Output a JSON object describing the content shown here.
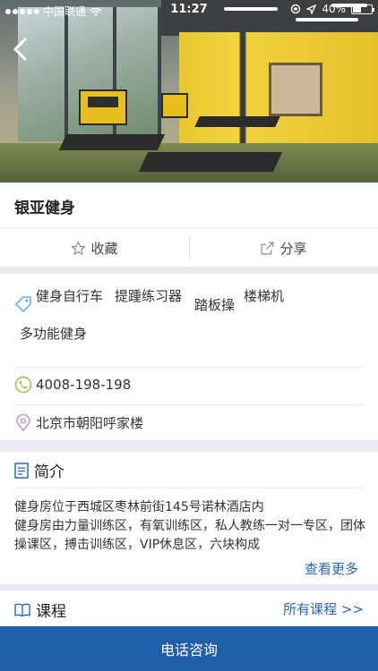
{
  "status_bar": {
    "carrier": "中国联通",
    "time": "11:27",
    "battery": "40%"
  },
  "header": {
    "back_icon": "chevron-left-icon"
  },
  "gym": {
    "name": "银亚健身"
  },
  "actions": {
    "favorite_label": "收藏",
    "share_label": "分享"
  },
  "info": {
    "tags": [
      "健身自行车",
      "提踵练习器",
      "踏板操",
      "楼梯机",
      "多功能健身"
    ],
    "phone": "4008-198-198",
    "address": "北京市朝阳呼家楼"
  },
  "intro": {
    "title": "简介",
    "description": "健身房位于西城区枣林前街145号诺林酒店内\n健身房由力量训练区，有氧训练区，私人教练一对一专区，团体操课区，搏击训练区，VIP休息区，六块构成",
    "more_label": "查看更多"
  },
  "course": {
    "title": "课程",
    "all_label": "所有课程 >>"
  },
  "footer": {
    "call_label": "电话咨询"
  },
  "colors": {
    "accent": "#1f5ea8",
    "link": "#2b6aa8",
    "background": "#e9e9ef"
  }
}
